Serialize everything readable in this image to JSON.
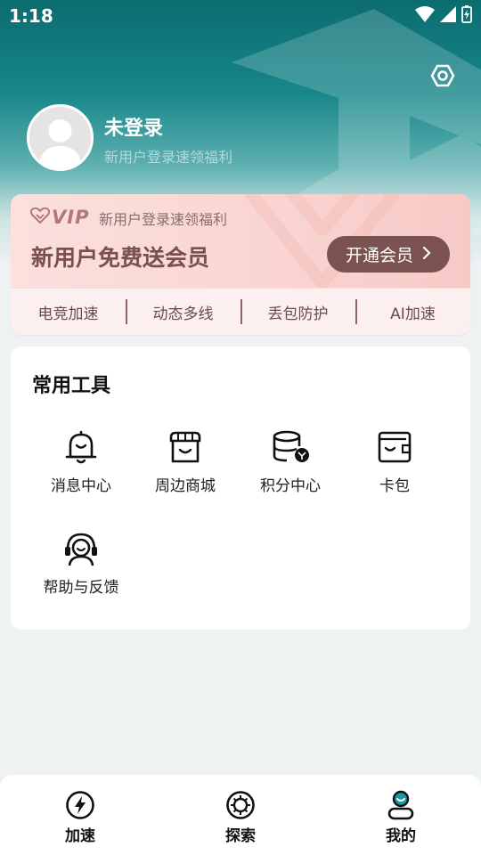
{
  "status_bar": {
    "time": "1:18",
    "icons": [
      "wifi-icon",
      "signal-icon",
      "battery-charging-icon"
    ]
  },
  "header": {
    "settings_icon": "settings-icon"
  },
  "profile": {
    "name": "未登录",
    "subtitle": "新用户登录速领福利",
    "avatar_icon": "default-avatar-icon"
  },
  "vip": {
    "logo_text": "VIP",
    "subtitle": "新用户登录速领福利",
    "title": "新用户免费送会员",
    "button_label": "开通会员",
    "features": [
      "电竞加速",
      "动态多线",
      "丢包防护",
      "AI加速"
    ]
  },
  "tools": {
    "title": "常用工具",
    "items": [
      {
        "label": "消息中心",
        "icon": "bell-icon"
      },
      {
        "label": "周边商城",
        "icon": "store-icon"
      },
      {
        "label": "积分中心",
        "icon": "coins-icon"
      },
      {
        "label": "卡包",
        "icon": "wallet-icon"
      },
      {
        "label": "帮助与反馈",
        "icon": "headset-icon"
      }
    ]
  },
  "bottom_nav": [
    {
      "label": "加速",
      "icon": "lightning-icon"
    },
    {
      "label": "探索",
      "icon": "explore-icon"
    },
    {
      "label": "我的",
      "icon": "profile-icon"
    }
  ],
  "colors": {
    "header_teal": "#0b6c70",
    "vip_button": "#7a5350",
    "vip_text": "#7a4f4f",
    "accent": "#1a9aa0"
  }
}
